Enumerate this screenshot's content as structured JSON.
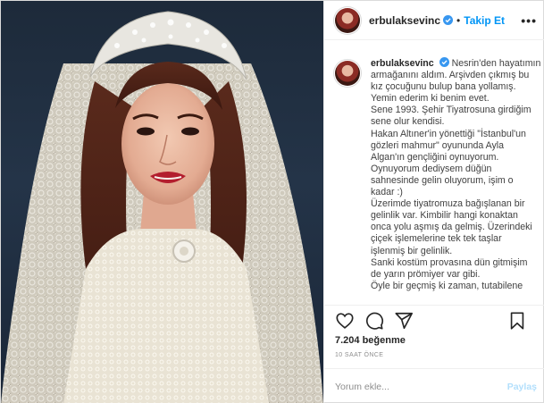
{
  "header": {
    "username": "erbulaksevinc",
    "separator": "•",
    "follow_label": "Takip Et",
    "more_label": "•••"
  },
  "caption": {
    "username": "erbulaksevinc",
    "lines": [
      "Nesrin'den hayatımın",
      "armağanını aldım. Arşivden çıkmış bu",
      "kız çocuğunu bulup bana yollamış.",
      "Yemin ederim ki benim evet.",
      "Sene 1993. Şehir Tiyatrosuna girdiğim",
      "sene olur kendisi.",
      "Hakan Altıner'in yönettiği \"İstanbul'un",
      "gözleri mahmur\" oyununda Ayla",
      "Algan'ın gençliğini oynuyorum.",
      "Oynuyorum dediysem düğün",
      "sahnesinde gelin oluyorum, işim o",
      "kadar :)",
      "Üzerimde tiyatromuza bağışlanan bir",
      "gelinlik var. Kimbilir hangi konaktan",
      "onca yolu aşmış da gelmiş. Üzerindeki",
      "çiçek işlemelerine tek tek taşlar",
      "işlenmiş bir gelinlik.",
      "Sanki kostüm provasına dün gitmişim",
      "de yarın prömiyer var gibi.",
      "Öyle bir geçmiş ki zaman, tutabilene"
    ]
  },
  "actions": {
    "like": "heart-icon",
    "comment": "comment-icon",
    "share": "share-icon",
    "save": "bookmark-icon"
  },
  "likes": "7.204 beğenme",
  "time": "10 SAAT ÖNCE",
  "comment": {
    "placeholder": "Yorum ekle...",
    "post_label": "Paylaş"
  },
  "colors": {
    "accent": "#0095f6",
    "muted": "#8e8e8e",
    "post_disabled": "#b2dffc",
    "border": "#dbdbdb"
  }
}
